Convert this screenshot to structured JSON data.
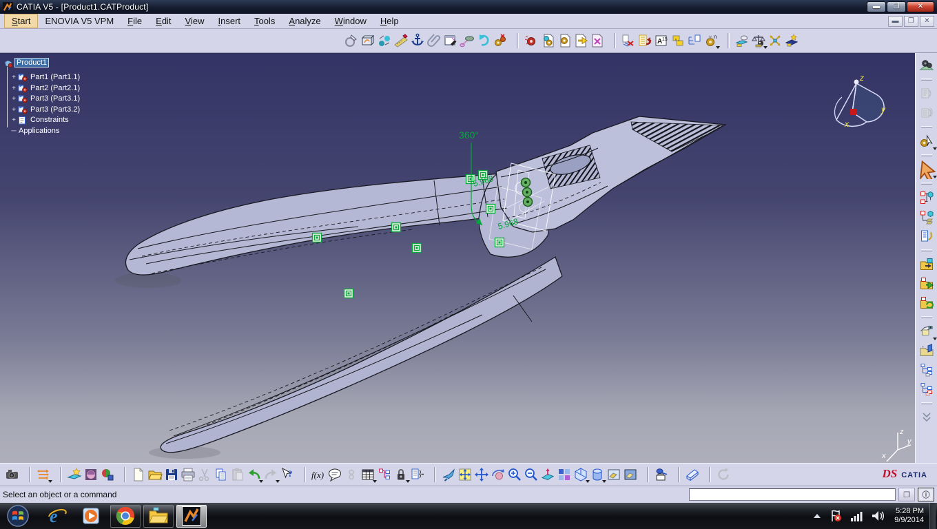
{
  "window": {
    "title": "CATIA V5 - [Product1.CATProduct]"
  },
  "menu": {
    "items": [
      {
        "label": "Start",
        "underline": 0,
        "highlight": true
      },
      {
        "label": "ENOVIA V5 VPM",
        "underline": -1
      },
      {
        "label": "File",
        "underline": 0
      },
      {
        "label": "Edit",
        "underline": 0
      },
      {
        "label": "View",
        "underline": 0
      },
      {
        "label": "Insert",
        "underline": 0
      },
      {
        "label": "Tools",
        "underline": 0
      },
      {
        "label": "Analyze",
        "underline": 0
      },
      {
        "label": "Window",
        "underline": 0
      },
      {
        "label": "Help",
        "underline": 0
      }
    ],
    "child_window_controls": [
      "minimize",
      "restore",
      "close"
    ]
  },
  "top_toolbar": {
    "groups": [
      [
        "update",
        "mockup",
        "move-ball",
        "ruler-pen",
        "anchor",
        "paperclip",
        "window-pen",
        "screwdriver",
        "undo-cyan",
        "gears-x"
      ],
      [
        "gear-red",
        "gear-doc-cyan",
        "gear-doc-yellow",
        "doc-arrow-yellow",
        "doc-magenta-x"
      ],
      [
        "paste-red-x",
        "list-red-undo",
        "frame-a15",
        "callout",
        "tree-doc",
        "gear-n+"
      ],
      [
        "clash",
        "balance+",
        "explode-x",
        "scene-star"
      ]
    ]
  },
  "right_toolbar": {
    "groups": [
      [
        "gears-green"
      ],
      [
        "catalog1",
        "catalog2"
      ],
      [
        "gear-cursor+"
      ],
      [
        "big-cursor+"
      ],
      [
        "prod-cube",
        "prod-tree",
        "list-pen"
      ],
      [
        "folder-cyan",
        "folder-green",
        "folder-refresh"
      ],
      [
        "camera-view+",
        "folder-open-blue",
        "tree-blue",
        "tree-red"
      ],
      [
        "chevrons"
      ]
    ]
  },
  "bottom_toolbar": {
    "groups": [
      [
        "camera"
      ],
      [
        "adjust+"
      ],
      [
        "wizard",
        "material",
        "render3"
      ],
      [
        "new-doc",
        "open-folder",
        "save",
        "print",
        "cut",
        "copy",
        "paste",
        "undo+",
        "redo+",
        "help-cursor"
      ],
      [
        "fx",
        "speech",
        "link",
        "design-table+",
        "tree-small",
        "lock+",
        "relations"
      ],
      [
        "fly",
        "fit-all",
        "pan",
        "rotate",
        "zoom-in",
        "zoom-out",
        "normal-view",
        "multi-view",
        "iso-cube+",
        "cylinder+",
        "view-shade1",
        "view-shade2"
      ],
      [
        "print-3d"
      ],
      [
        "measure"
      ],
      [
        "refresh-spin"
      ]
    ],
    "logo": {
      "ds": "DS",
      "brand": "CATIA"
    }
  },
  "tree": {
    "items": [
      {
        "label": "Product1",
        "icon": "product",
        "selected": true,
        "level": 0,
        "expander": false
      },
      {
        "label": "Part1 (Part1.1)",
        "icon": "part",
        "level": 1,
        "expander": true
      },
      {
        "label": "Part2 (Part2.1)",
        "icon": "part",
        "level": 1,
        "expander": true
      },
      {
        "label": "Part3 (Part3.1)",
        "icon": "part",
        "level": 1,
        "expander": true
      },
      {
        "label": "Part3 (Part3.2)",
        "icon": "part",
        "level": 1,
        "expander": true
      },
      {
        "label": "Constraints",
        "icon": "constraints",
        "level": 1,
        "expander": true
      },
      {
        "label": "Applications",
        "icon": "none",
        "level": 1,
        "expander": false
      }
    ]
  },
  "viewport": {
    "annotations": {
      "angle": "360°",
      "dim1": "5.968",
      "dim2": "5.968"
    },
    "compass": {
      "x": "x",
      "y": "y",
      "z": "z"
    },
    "triad": {
      "x": "x",
      "y": "y",
      "z": "z"
    },
    "colors": {
      "bg_top": "#333365",
      "bg_bottom": "#aeafbb",
      "model_fill": "#b6b9d6",
      "annotation_green": "#00a838",
      "compass_red": "#c81818"
    }
  },
  "status_bar": {
    "message": "Select an object or a command",
    "power_input": {
      "value": "",
      "placeholder": ""
    }
  },
  "taskbar": {
    "buttons": [
      "start",
      "internet-explorer",
      "windows-media-player",
      "chrome",
      "file-explorer",
      "catia"
    ],
    "tray": {
      "icons": [
        "tray-expand",
        "action-center-flag",
        "network-signal",
        "volume-speaker"
      ],
      "time": "5:28 PM",
      "date": "9/9/2014"
    }
  }
}
